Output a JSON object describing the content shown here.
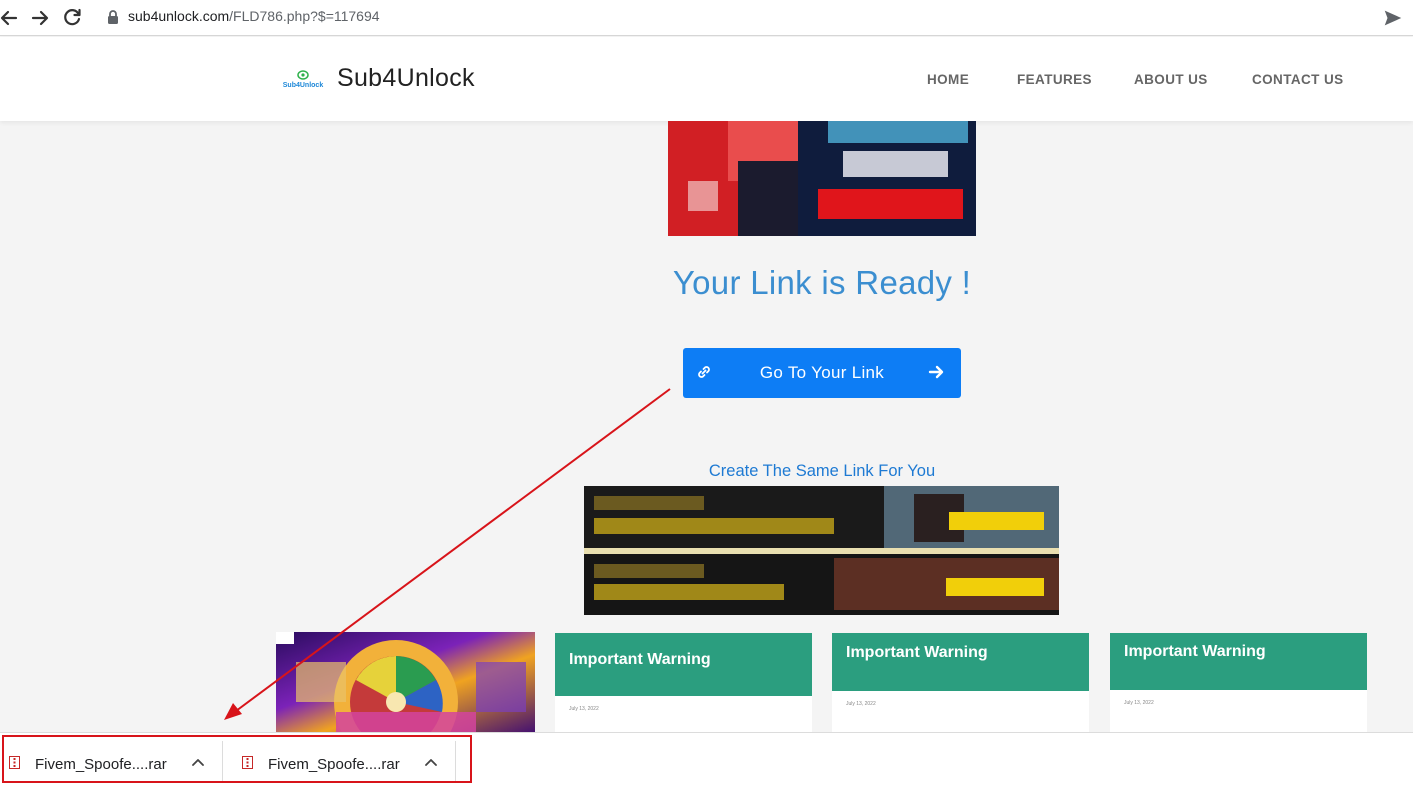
{
  "browser": {
    "url_domain": "sub4unlock.com",
    "url_path": "/FLD786.php?$=117694"
  },
  "header": {
    "logo_text": "Sub4Unlock",
    "site_title": "Sub4Unlock",
    "nav": [
      "HOME",
      "FEATURES",
      "ABOUT US",
      "CONTACT US"
    ]
  },
  "main": {
    "ready_title": "Your Link is Ready !",
    "go_button_label": "Go To Your Link",
    "create_link_text": "Create The Same Link For You"
  },
  "cards": [
    {
      "title": "Important Warning",
      "date": "July 13, 2022"
    },
    {
      "title": "Important Warning",
      "date": "July 13, 2022"
    },
    {
      "title": "Important Warning",
      "date": "July 13, 2022"
    }
  ],
  "downloads": [
    {
      "name": "Fivem_Spoofe....rar"
    },
    {
      "name": "Fivem_Spoofe....rar"
    }
  ],
  "colors": {
    "accent_blue": "#0d7df5",
    "title_blue": "#3b8ed0",
    "card_green": "#2b9e7f",
    "annotation_red": "#d8141a"
  }
}
